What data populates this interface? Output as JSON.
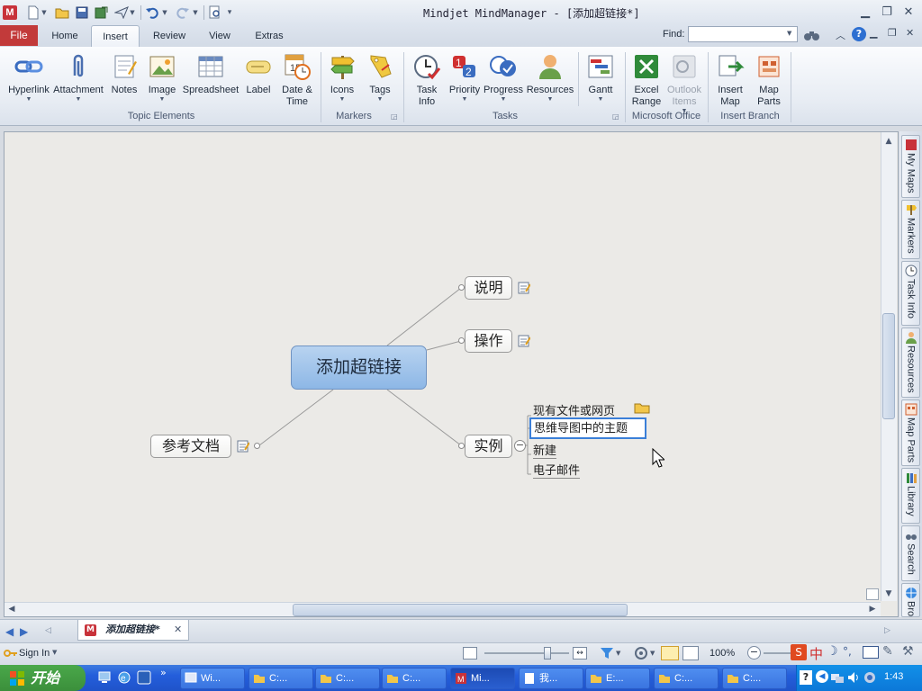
{
  "window": {
    "title": "Mindjet MindManager - [添加超链接*]"
  },
  "tabs": {
    "file": "File",
    "home": "Home",
    "insert": "Insert",
    "review": "Review",
    "view": "View",
    "extras": "Extras"
  },
  "find": {
    "label": "Find:",
    "value": ""
  },
  "ribbon": {
    "topic_elements": {
      "group": "Topic Elements",
      "hyperlink": "Hyperlink",
      "attachment": "Attachment",
      "notes": "Notes",
      "image": "Image",
      "spreadsheet": "Spreadsheet",
      "label": "Label",
      "date_time": "Date &\nTime"
    },
    "markers": {
      "group": "Markers",
      "icons": "Icons",
      "tags": "Tags"
    },
    "tasks": {
      "group": "Tasks",
      "task_info": "Task\nInfo",
      "priority": "Priority",
      "progress": "Progress",
      "resources": "Resources",
      "gantt": "Gantt"
    },
    "office": {
      "group": "Microsoft Office",
      "excel": "Excel\nRange",
      "outlook": "Outlook\nItems"
    },
    "insert_branch": {
      "group": "Insert Branch",
      "insert_map": "Insert\nMap",
      "map_parts": "Map\nParts"
    }
  },
  "map": {
    "central": "添加超链接",
    "topics": {
      "t1": "说明",
      "t2": "操作",
      "t3": "实例",
      "t4": "参考文档"
    },
    "subtopics": {
      "s1": "现有文件或网页",
      "s2": "思维导图中的主题",
      "s3": "新建",
      "s4": "电子邮件"
    }
  },
  "side_panel": {
    "my_maps": "My Maps",
    "markers": "Markers",
    "task_info": "Task Info",
    "resources": "Resources",
    "map_parts": "Map Parts",
    "library": "Library",
    "search": "Search",
    "browser": "Browser"
  },
  "doc_tab": {
    "label": "添加超链接*"
  },
  "status": {
    "sign_in": "Sign In",
    "zoom": "100%"
  },
  "taskbar": {
    "start": "开始",
    "buttons": {
      "b1": "Wi...",
      "b2": "C:...",
      "b3": "C:...",
      "b4": "C:...",
      "b5": "Mi...",
      "b6": "我...",
      "b7": "E:...",
      "b8": "C:...",
      "b9": "C:..."
    },
    "ime": "中",
    "clock": "1:43"
  },
  "colors": {
    "file_tab": "#c23a3a",
    "central_topic": "#8db7e6",
    "taskbar": "#245edb",
    "start_button": "#3b8f3b"
  }
}
